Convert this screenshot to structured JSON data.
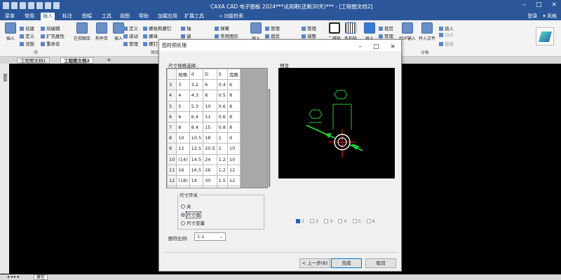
{
  "window": {
    "title": "CAXA CAD 电子图板 2024***试用期(还剩30天)*** - [工程图文档2]",
    "login": "登录",
    "style": "风格"
  },
  "menu": [
    "菜单",
    "常用",
    "插入",
    "标注",
    "图幅",
    "工具",
    "视图",
    "帮助",
    "加载应用",
    "扩展工具"
  ],
  "menu_active": "插入",
  "search_placeholder": "功能检索",
  "ribbon": {
    "insert_big": "插入",
    "block_items": [
      "创建",
      "块编辑",
      "定义",
      "扩充属性",
      "消隐",
      "重命名"
    ],
    "block_group": "块",
    "buttons": [
      "在视图库",
      "构件库",
      "插入"
    ],
    "col3": [
      "定义",
      "驱动",
      "管理"
    ],
    "col4": [
      "螺栓和螺钉",
      "螺母",
      "螺钉"
    ],
    "col5": [
      "轴",
      "键",
      "销"
    ],
    "col6": [
      "弹簧",
      "常用图形",
      "插入"
    ],
    "big_insert2": "插入",
    "tu_group": "图库",
    "col7": [
      "管理",
      "裁剪"
    ],
    "col8": [
      "管理",
      "调整",
      "插入"
    ],
    "qr": [
      "二维码",
      "条形码"
    ],
    "pdf": [
      "插入",
      "裁剪",
      "管理"
    ],
    "pdf_big": "PDF输入",
    "insert_file": "并入文件",
    "obj": [
      "插入",
      "OLE",
      "链接"
    ],
    "obj_group": "对象"
  },
  "doc_tabs": [
    "工程图文档1",
    "工程图文档2"
  ],
  "left_panel": "图库",
  "status_model": "模型",
  "dialog": {
    "title": "图符预处理",
    "size_label": "尺寸规格选择:",
    "preview_label": "预显",
    "table_headers": [
      "规格",
      "d",
      "D",
      "S",
      "齿数"
    ],
    "rows": [
      [
        "3",
        "3",
        "3.2",
        "6",
        "0.4",
        "6"
      ],
      [
        "4",
        "4",
        "4.3",
        "8",
        "0.5",
        "8"
      ],
      [
        "5",
        "5",
        "5.3",
        "10",
        "0.6",
        "8"
      ],
      [
        "6",
        "6",
        "6.4",
        "11",
        "0.6",
        "8"
      ],
      [
        "7",
        "8",
        "8.4",
        "15",
        "0.8",
        "8"
      ],
      [
        "8",
        "10",
        "10.5",
        "18",
        "1",
        "9"
      ],
      [
        "9",
        "12",
        "12.5",
        "20.5",
        "1",
        "10"
      ],
      [
        "10",
        "(14)",
        "14.5",
        "24",
        "1.2",
        "10"
      ],
      [
        "11",
        "16",
        "16.5",
        "26",
        "1.2",
        "12"
      ],
      [
        "12",
        "(18)",
        "19",
        "30",
        "1.5",
        "12"
      ],
      [
        "13",
        "20",
        "21",
        "33",
        "1.5",
        "12"
      ]
    ],
    "switch_label": "尺寸开关",
    "radios": [
      "关",
      "尺寸值",
      "尺寸变量"
    ],
    "radio_selected": 1,
    "scale_label": "图符比例:",
    "scale_value": "1:1",
    "pages": [
      "1",
      "2",
      "3",
      "4",
      "5",
      "6"
    ],
    "pages_checked": [
      "1"
    ],
    "btn_prev": "< 上一步(B)",
    "btn_finish": "完成",
    "btn_cancel": "取消"
  },
  "colors": {
    "accent": "#2b579a",
    "preview_green": "#22cc33",
    "preview_red": "#ff2222"
  }
}
